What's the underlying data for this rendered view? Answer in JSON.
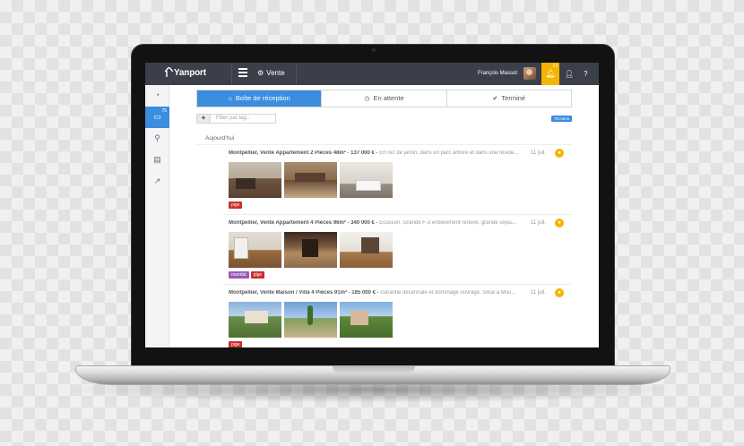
{
  "app": {
    "logo": "Yanport",
    "section": "Vente",
    "user_name": "François Massot",
    "notification_count": "12"
  },
  "sidebar": {
    "items": [
      {
        "icon": "dashboard-icon"
      },
      {
        "icon": "inbox-icon",
        "badge": "75",
        "active": true
      },
      {
        "icon": "search-icon"
      },
      {
        "icon": "book-icon"
      },
      {
        "icon": "chart-icon"
      }
    ]
  },
  "tabs": [
    {
      "label": "Boîte de réception",
      "icon": "inbox-icon",
      "active": true
    },
    {
      "label": "En attente",
      "icon": "clock-icon"
    },
    {
      "label": "Terminé",
      "icon": "check-icon"
    }
  ],
  "filter": {
    "placeholder": "Filter par tag...",
    "count_badge": "75 biens"
  },
  "day_label": "Aujourd'hui",
  "listings": [
    {
      "title": "Montpellier, Vente Appartement 2 Pièces 48m²",
      "price": "137 000 €",
      "description": "En rez de jardin, dans un parc arboré et dans une réside...",
      "date": "11 juil.",
      "tags": [
        "pige"
      ]
    },
    {
      "title": "Montpellier, Vente Appartement 4 Pièces 96m²",
      "price": "340 000 €",
      "description": "Ecusson, Grande F-3 entièrement rénové, grande séjou...",
      "date": "11 juil.",
      "tags": [
        "mandat",
        "pige"
      ]
    },
    {
      "title": "Montpellier, Vente Maison / Villa 4 Pièces 91m²",
      "price": "185 000 €",
      "description": "Garantie décennale et dommage ouvrage. Situé à Mou...",
      "date": "11 juil.",
      "tags": [
        "pige"
      ]
    }
  ],
  "colors": {
    "accent": "#3c8dde",
    "topbar": "#3b3f4a",
    "notification": "#f5b400",
    "tag_pige": "#c9302c",
    "tag_mandat": "#9b59b6"
  }
}
